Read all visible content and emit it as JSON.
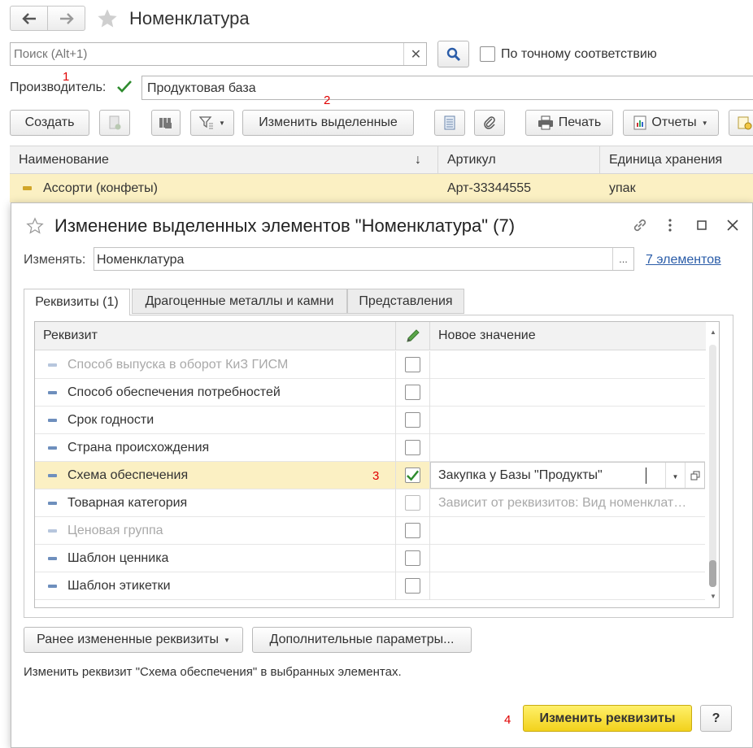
{
  "window": {
    "title": "Номенклатура"
  },
  "search": {
    "placeholder": "Поиск (Alt+1)",
    "exact_label": "По точному соответствию"
  },
  "filter": {
    "label": "Производитель:",
    "value": "Продуктовая база"
  },
  "annotations": {
    "a1": "1",
    "a2": "2",
    "a3": "3",
    "a4": "4"
  },
  "toolbar": {
    "create": "Создать",
    "edit_selected": "Изменить выделенные",
    "print": "Печать",
    "reports": "Отчеты"
  },
  "list": {
    "columns": {
      "name": "Наименование",
      "sort_arrow": "↓",
      "article": "Артикул",
      "unit": "Единица хранения"
    },
    "row": {
      "name": "Ассорти (конфеты)",
      "article": "Арт-33344555",
      "unit": "упак"
    }
  },
  "dialog": {
    "title": "Изменение выделенных элементов \"Номенклатура\" (7)",
    "change_label": "Изменять:",
    "change_value": "Номенклатура",
    "ellipsis": "...",
    "elements_link": "7 элементов",
    "tabs": [
      "Реквизиты (1)",
      "Драгоценные металлы и камни",
      "Представления"
    ],
    "grid": {
      "col_attr": "Реквизит",
      "col_value": "Новое значение",
      "rows": [
        {
          "name": "Способ выпуска в оборот КиЗ ГИСМ",
          "value": ""
        },
        {
          "name": "Способ обеспечения потребностей",
          "value": ""
        },
        {
          "name": "Срок годности",
          "value": ""
        },
        {
          "name": "Страна происхождения",
          "value": ""
        },
        {
          "name": "Схема обеспечения",
          "value": "Закупка у Базы \"Продукты\""
        },
        {
          "name": "Товарная категория",
          "value": "Зависит от реквизитов: Вид номенклат…"
        },
        {
          "name": "Ценовая группа",
          "value": ""
        },
        {
          "name": "Шаблон ценника",
          "value": ""
        },
        {
          "name": "Шаблон этикетки",
          "value": ""
        }
      ]
    },
    "btn_prev_changed": "Ранее измененные реквизиты",
    "btn_extra_params": "Дополнительные параметры...",
    "status": "Изменить реквизит \"Схема обеспечения\" в выбранных элементах.",
    "btn_apply": "Изменить реквизиты",
    "btn_help": "?"
  },
  "colors": {
    "accent_yellow": "#fbe54e",
    "selected_row": "#fbf0c3",
    "link": "#2a5ca8",
    "check_green": "#2e8b2e"
  }
}
